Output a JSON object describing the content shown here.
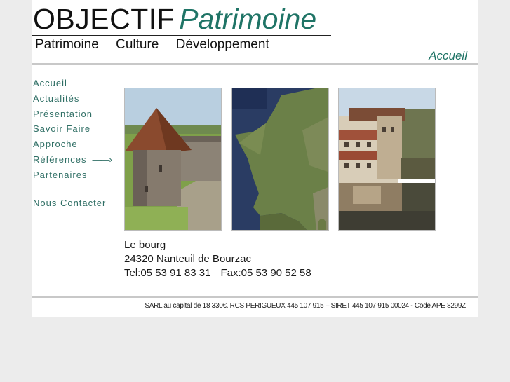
{
  "header": {
    "logo_part1": "OBJECTIF",
    "logo_part2": "Patrimoine",
    "nav": [
      "Patrimoine",
      "Culture",
      "Développement"
    ],
    "current_page": "Accueil"
  },
  "sidebar": {
    "items": [
      {
        "label": "Accueil"
      },
      {
        "label": "Actualités"
      },
      {
        "label": "Présentation"
      },
      {
        "label": "Savoir Faire"
      },
      {
        "label": "Approche"
      },
      {
        "label": "Références",
        "arrow": "——›"
      },
      {
        "label": "Partenaires"
      }
    ],
    "contact": "Nous Contacter"
  },
  "photos": [
    {
      "name": "round-tower-photo",
      "alt": "tower"
    },
    {
      "name": "france-satellite-photo",
      "alt": "map"
    },
    {
      "name": "riverside-village-photo",
      "alt": "village"
    }
  ],
  "address": {
    "line1": "Le bourg",
    "line2": "24320 Nanteuil de Bourzac",
    "tel": "Tel:05 53 91 83 31",
    "fax": "Fax:05 53 90 52 58"
  },
  "footer": {
    "text": "SARL au capital de 18 330€. RCS PERIGUEUX 445 107 915 – SIRET 445 107 915 00024 - Code APE 8299Z"
  },
  "colors": {
    "accent": "#1f7466",
    "nav_link": "#2e6e64",
    "background": "#ececec"
  }
}
